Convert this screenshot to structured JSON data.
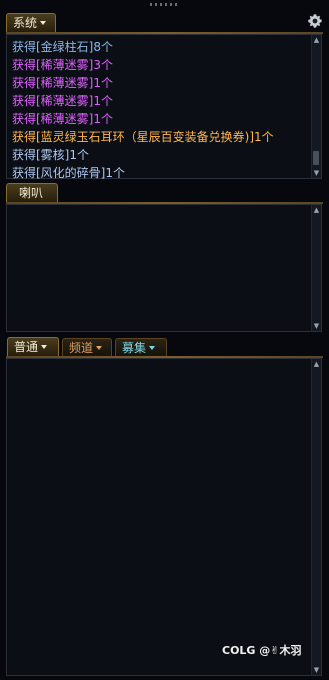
{
  "top_panel": {
    "tab_label": "系统",
    "messages": [
      {
        "text": "获得[金绿柱石]8个",
        "color": "blue"
      },
      {
        "text": "获得[稀薄迷雾]3个",
        "color": "purple"
      },
      {
        "text": "获得[稀薄迷雾]1个",
        "color": "purple"
      },
      {
        "text": "获得[稀薄迷雾]1个",
        "color": "purple"
      },
      {
        "text": "获得[稀薄迷雾]1个",
        "color": "purple"
      },
      {
        "text": "获得[蓝灵绿玉石耳环（星辰百变装备兑换券)]1个",
        "color": "orange"
      },
      {
        "text": "获得[雾核]1个",
        "color": "pale"
      },
      {
        "text": "获得[风化的碎骨]1个",
        "color": "pale"
      }
    ]
  },
  "middle_panel": {
    "tab_label": "喇叭"
  },
  "bottom_panel": {
    "tabs": [
      {
        "label": "普通",
        "color": "#f2ead3"
      },
      {
        "label": "频道",
        "color": "#e0a060"
      },
      {
        "label": "募集",
        "color": "#7fd7e6"
      }
    ]
  },
  "watermark": "COLG @✌木羽",
  "colors": {
    "purple": "#e060ff",
    "blue": "#8fb6e6",
    "orange": "#ffb74d",
    "pale": "#aec8ef",
    "gold_border": "#7b5f2a"
  }
}
